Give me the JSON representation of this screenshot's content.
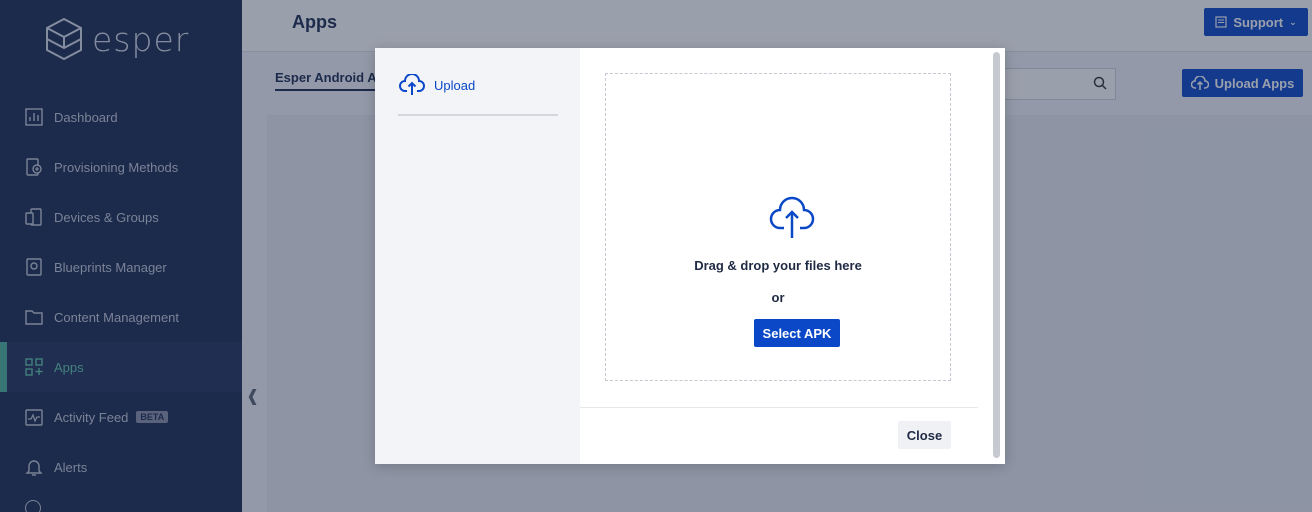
{
  "app": {
    "logo_text": "esper",
    "page_title": "Apps"
  },
  "sidebar": {
    "items": [
      {
        "label": "Dashboard",
        "icon": "chart-icon"
      },
      {
        "label": "Provisioning Methods",
        "icon": "provision-icon"
      },
      {
        "label": "Devices & Groups",
        "icon": "devices-icon"
      },
      {
        "label": "Blueprints Manager",
        "icon": "blueprint-icon"
      },
      {
        "label": "Content Management",
        "icon": "folder-icon"
      },
      {
        "label": "Apps",
        "icon": "apps-icon",
        "active": true
      },
      {
        "label": "Activity Feed",
        "icon": "activity-icon",
        "badge": "BETA"
      },
      {
        "label": "Alerts",
        "icon": "bell-icon"
      }
    ]
  },
  "header": {
    "support_label": "Support"
  },
  "main": {
    "tab_label": "Esper Android Apps",
    "upload_apps_label": "Upload Apps"
  },
  "modal": {
    "step_label": "Upload",
    "drop_text": "Drag & drop your files here",
    "or_text": "or",
    "select_label": "Select APK",
    "close_label": "Close"
  },
  "colors": {
    "sidebar_bg": "#1a2a4f",
    "accent": "#0a48c7",
    "active_green": "#5fc9a8"
  }
}
